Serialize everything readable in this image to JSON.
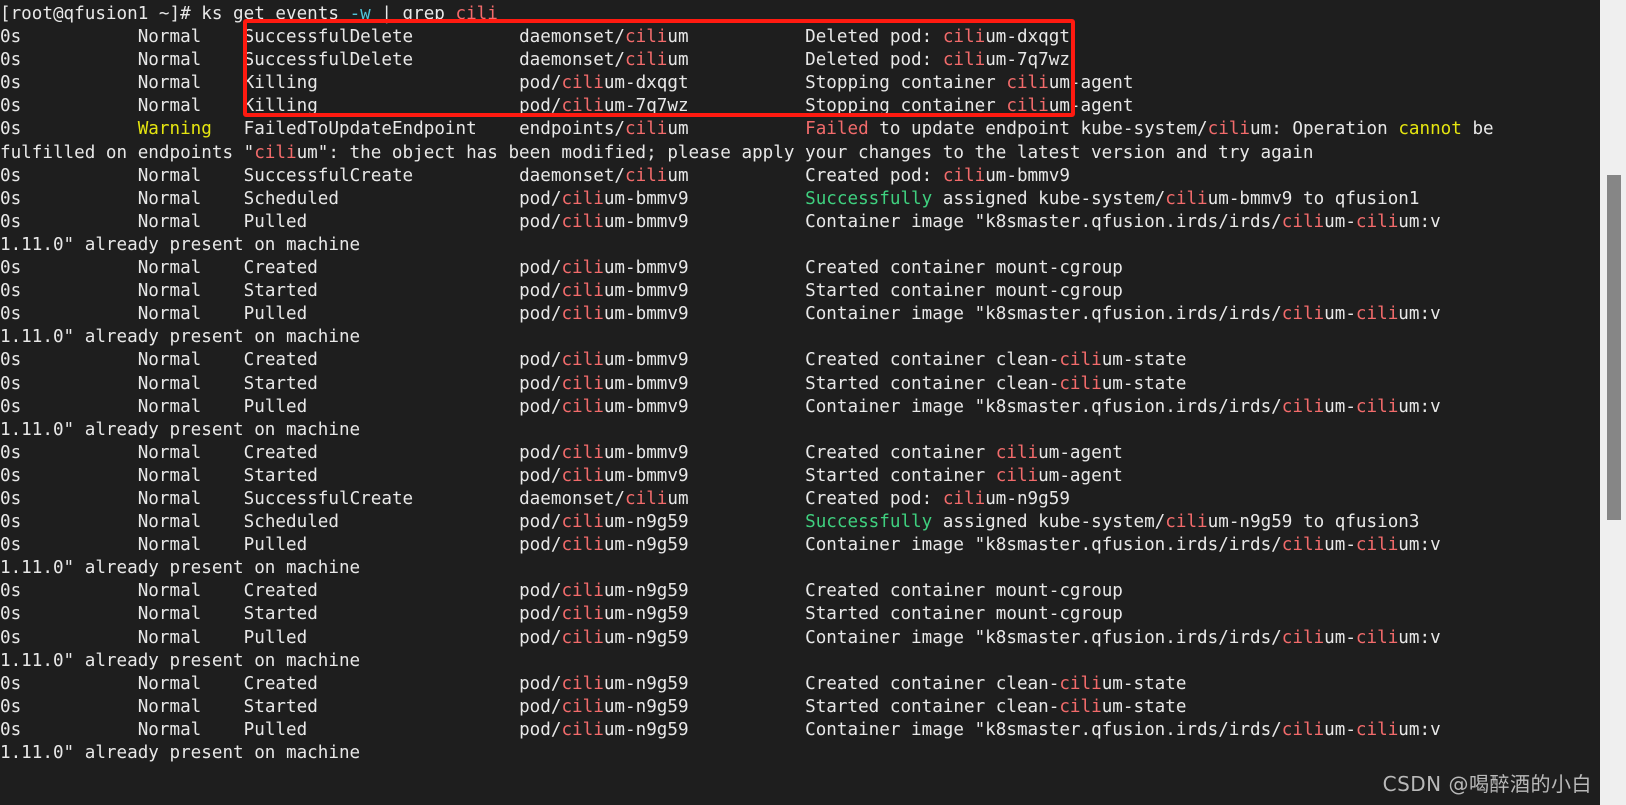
{
  "terminal": {
    "background_color": "#1e1e1e",
    "foreground_color": "#e6e6e6",
    "prompt": "[root@qfusion1 ~]# ",
    "command": "ks get events ",
    "command_flag": "-w",
    "command_pipe": " | grep cili",
    "colors": {
      "match_red": "#f26b6b",
      "warning_yellow": "#e5e510",
      "success_green": "#3fd07f",
      "flag_cyan": "#4fc1d6",
      "annotation_red": "#ff1a10"
    },
    "lines": [
      {
        "age": "0s",
        "type": "Normal",
        "reason": "SuccessfulDelete",
        "object_prefix": "daemonset/",
        "object_name": "cilium",
        "message_pre": "Deleted pod: ",
        "message_obj": "cilium-dxqgt",
        "message_post": ""
      },
      {
        "age": "0s",
        "type": "Normal",
        "reason": "SuccessfulDelete",
        "object_prefix": "daemonset/",
        "object_name": "cilium",
        "message_pre": "Deleted pod: ",
        "message_obj": "cilium-7q7wz",
        "message_post": ""
      },
      {
        "age": "0s",
        "type": "Normal",
        "reason": "Killing",
        "object_prefix": "pod/",
        "object_name": "cilium-dxqgt",
        "message_pre": "Stopping container ",
        "message_obj": "cilium-agent",
        "message_post": ""
      },
      {
        "age": "0s",
        "type": "Normal",
        "reason": "Killing",
        "object_prefix": "pod/",
        "object_name": "cilium-7q7wz",
        "message_pre": "Stopping container ",
        "message_obj": "cilium-agent",
        "message_post": ""
      },
      {
        "age": "0s",
        "type": "Warning",
        "reason": "FailedToUpdateEndpoint",
        "object_prefix": "endpoints/",
        "object_name": "cilium",
        "message_pre": "Failed",
        "message_obj": "",
        "message_post": " to update endpoint kube-system/cilium: Operation cannot be"
      },
      {
        "continuation": "fulfilled on endpoints \"cilium\": the object has been modified; please apply your changes to the latest version and try again"
      },
      {
        "age": "0s",
        "type": "Normal",
        "reason": "SuccessfulCreate",
        "object_prefix": "daemonset/",
        "object_name": "cilium",
        "message_pre": "Created pod: ",
        "message_obj": "cilium-bmmv9",
        "message_post": ""
      },
      {
        "age": "0s",
        "type": "Normal",
        "reason": "Scheduled",
        "object_prefix": "pod/",
        "object_name": "cilium-bmmv9",
        "message_pre": "Successfully",
        "message_obj": "",
        "message_post": " assigned kube-system/cilium-bmmv9 to qfusion1"
      },
      {
        "age": "0s",
        "type": "Normal",
        "reason": "Pulled",
        "object_prefix": "pod/",
        "object_name": "cilium-bmmv9",
        "message_pre": "Container image \"k8smaster.qfusion.irds/irds/cilium-cilium:v",
        "message_obj": "",
        "message_post": ""
      },
      {
        "continuation": "1.11.0\" already present on machine"
      },
      {
        "age": "0s",
        "type": "Normal",
        "reason": "Created",
        "object_prefix": "pod/",
        "object_name": "cilium-bmmv9",
        "message_pre": "Created container mount-cgroup",
        "message_obj": "",
        "message_post": ""
      },
      {
        "age": "0s",
        "type": "Normal",
        "reason": "Started",
        "object_prefix": "pod/",
        "object_name": "cilium-bmmv9",
        "message_pre": "Started container mount-cgroup",
        "message_obj": "",
        "message_post": ""
      },
      {
        "age": "0s",
        "type": "Normal",
        "reason": "Pulled",
        "object_prefix": "pod/",
        "object_name": "cilium-bmmv9",
        "message_pre": "Container image \"k8smaster.qfusion.irds/irds/cilium-cilium:v",
        "message_obj": "",
        "message_post": ""
      },
      {
        "continuation": "1.11.0\" already present on machine"
      },
      {
        "age": "0s",
        "type": "Normal",
        "reason": "Created",
        "object_prefix": "pod/",
        "object_name": "cilium-bmmv9",
        "message_pre": "Created container clean-cilium-state",
        "message_obj": "",
        "message_post": ""
      },
      {
        "age": "0s",
        "type": "Normal",
        "reason": "Started",
        "object_prefix": "pod/",
        "object_name": "cilium-bmmv9",
        "message_pre": "Started container clean-cilium-state",
        "message_obj": "",
        "message_post": ""
      },
      {
        "age": "0s",
        "type": "Normal",
        "reason": "Pulled",
        "object_prefix": "pod/",
        "object_name": "cilium-bmmv9",
        "message_pre": "Container image \"k8smaster.qfusion.irds/irds/cilium-cilium:v",
        "message_obj": "",
        "message_post": ""
      },
      {
        "continuation": "1.11.0\" already present on machine"
      },
      {
        "age": "0s",
        "type": "Normal",
        "reason": "Created",
        "object_prefix": "pod/",
        "object_name": "cilium-bmmv9",
        "message_pre": "Created container cilium-agent",
        "message_obj": "",
        "message_post": ""
      },
      {
        "age": "0s",
        "type": "Normal",
        "reason": "Started",
        "object_prefix": "pod/",
        "object_name": "cilium-bmmv9",
        "message_pre": "Started container cilium-agent",
        "message_obj": "",
        "message_post": ""
      },
      {
        "age": "0s",
        "type": "Normal",
        "reason": "SuccessfulCreate",
        "object_prefix": "daemonset/",
        "object_name": "cilium",
        "message_pre": "Created pod: ",
        "message_obj": "cilium-n9g59",
        "message_post": ""
      },
      {
        "age": "0s",
        "type": "Normal",
        "reason": "Scheduled",
        "object_prefix": "pod/",
        "object_name": "cilium-n9g59",
        "message_pre": "Successfully",
        "message_obj": "",
        "message_post": " assigned kube-system/cilium-n9g59 to qfusion3"
      },
      {
        "age": "0s",
        "type": "Normal",
        "reason": "Pulled",
        "object_prefix": "pod/",
        "object_name": "cilium-n9g59",
        "message_pre": "Container image \"k8smaster.qfusion.irds/irds/cilium-cilium:v",
        "message_obj": "",
        "message_post": ""
      },
      {
        "continuation": "1.11.0\" already present on machine"
      },
      {
        "age": "0s",
        "type": "Normal",
        "reason": "Created",
        "object_prefix": "pod/",
        "object_name": "cilium-n9g59",
        "message_pre": "Created container mount-cgroup",
        "message_obj": "",
        "message_post": ""
      },
      {
        "age": "0s",
        "type": "Normal",
        "reason": "Started",
        "object_prefix": "pod/",
        "object_name": "cilium-n9g59",
        "message_pre": "Started container mount-cgroup",
        "message_obj": "",
        "message_post": ""
      },
      {
        "age": "0s",
        "type": "Normal",
        "reason": "Pulled",
        "object_prefix": "pod/",
        "object_name": "cilium-n9g59",
        "message_pre": "Container image \"k8smaster.qfusion.irds/irds/cilium-cilium:v",
        "message_obj": "",
        "message_post": ""
      },
      {
        "continuation": "1.11.0\" already present on machine"
      },
      {
        "age": "0s",
        "type": "Normal",
        "reason": "Created",
        "object_prefix": "pod/",
        "object_name": "cilium-n9g59",
        "message_pre": "Created container clean-cilium-state",
        "message_obj": "",
        "message_post": ""
      },
      {
        "age": "0s",
        "type": "Normal",
        "reason": "Started",
        "object_prefix": "pod/",
        "object_name": "cilium-n9g59",
        "message_pre": "Started container clean-cilium-state",
        "message_obj": "",
        "message_post": ""
      },
      {
        "age": "0s",
        "type": "Normal",
        "reason": "Pulled",
        "object_prefix": "pod/",
        "object_name": "cilium-n9g59",
        "message_pre": "Container image \"k8smaster.qfusion.irds/irds/cilium-cilium:v",
        "message_obj": "",
        "message_post": ""
      },
      {
        "continuation": "1.11.0\" already present on machine"
      }
    ]
  },
  "annotation": {
    "shape": "rectangle",
    "color": "#ff1a10"
  },
  "scrollbar": {
    "orientation": "vertical",
    "track_color": "#efefef",
    "thumb_color": "#868686"
  },
  "watermark": {
    "text": "CSDN @喝醉酒的小白"
  }
}
